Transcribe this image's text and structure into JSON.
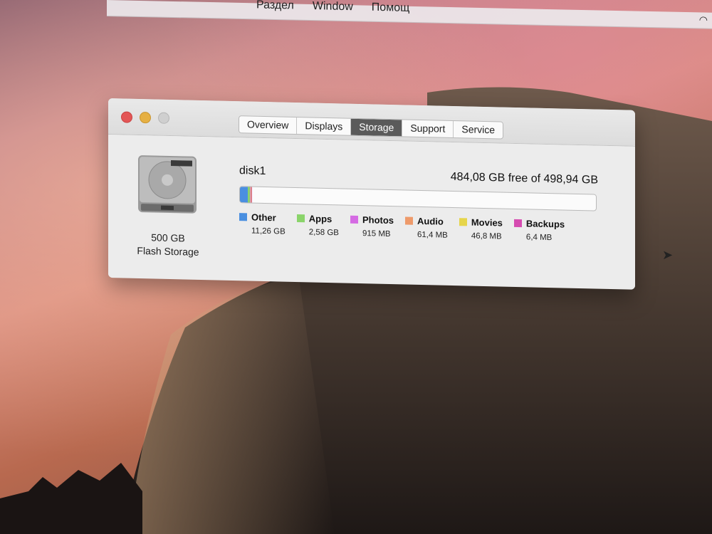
{
  "menubar": {
    "items": [
      "Раздел",
      "Window",
      "Помощ"
    ]
  },
  "window": {
    "tabs": [
      {
        "label": "Overview",
        "active": false
      },
      {
        "label": "Displays",
        "active": false
      },
      {
        "label": "Storage",
        "active": true
      },
      {
        "label": "Support",
        "active": false
      },
      {
        "label": "Service",
        "active": false
      }
    ],
    "disk": {
      "capacity": "500 GB",
      "type": "Flash Storage",
      "name": "disk1",
      "free_text": "484,08 GB free of 498,94 GB"
    },
    "legend": [
      {
        "label": "Other",
        "size": "11,26 GB",
        "color": "#4a8fe0"
      },
      {
        "label": "Apps",
        "size": "2,58 GB",
        "color": "#8ad46a"
      },
      {
        "label": "Photos",
        "size": "915 MB",
        "color": "#d56be3"
      },
      {
        "label": "Audio",
        "size": "61,4 MB",
        "color": "#ee9a6a"
      },
      {
        "label": "Movies",
        "size": "46,8 MB",
        "color": "#e6d54a"
      },
      {
        "label": "Backups",
        "size": "6,4 MB",
        "color": "#d54bb0"
      }
    ],
    "usage_fraction": {
      "other": 0.0226,
      "apps": 0.0052,
      "photos": 0.0018,
      "audio": 0.0012,
      "movies": 0.001,
      "backups": 0.0008
    }
  }
}
